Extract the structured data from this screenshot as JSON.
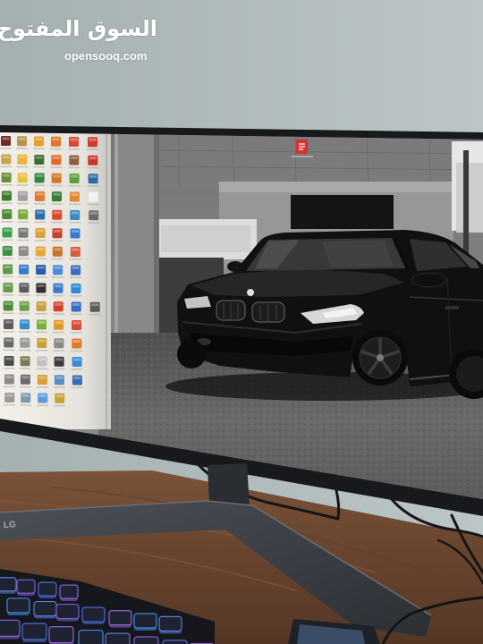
{
  "watermark": {
    "arabic": "السوق المفتوح",
    "latin": "opensooq.com"
  },
  "monitor": {
    "brand": "LG"
  },
  "desktop": {
    "pdf_icon_color": "#d8322c",
    "icon_colors": [
      [
        "#6e2a24",
        "#b89250",
        "#e2a02e",
        "#e0742a",
        "#d94a36",
        "#d33a2e"
      ],
      [
        "#c9a24a",
        "#e6b23a",
        "#3a6e2e",
        "#e06a2a",
        "#8e5a3a",
        "#c73428"
      ],
      [
        "#6a8e3a",
        "#e8c03a",
        "#2e8a3e",
        "#d8742a",
        "#5aa03a",
        "#2a6aa8"
      ],
      [
        "#3e7a2e",
        "#a0a0a0",
        "#e07a2a",
        "#3a7a3a",
        "#e08a30",
        "#f0f0f0"
      ],
      [
        "#4a8a3a",
        "#7aaa3a",
        "#2e6ea0",
        "#d84a2a",
        "#3a8ac0",
        "#6a6a6a"
      ],
      [
        "#3aa04a",
        "#7a7a7a",
        "#d8a03a",
        "#c8402a",
        "#3a7ad0",
        null
      ],
      [
        "#3e8e3e",
        "#8a8a8a",
        "#e6a63a",
        "#c9702a",
        "#d85a3a",
        null
      ],
      [
        "#5a9a4a",
        "#3a7ac8",
        "#2a5ab0",
        "#4a8ad8",
        "#3a6ac0",
        null
      ],
      [
        "#6a9a4a",
        "#5a5a5a",
        "#2e2e2e",
        "#3a78c8",
        "#2a8ad8",
        null
      ],
      [
        "#4a8a3a",
        "#6aa04a",
        "#c8a03a",
        "#d0402a",
        "#3a6ac8",
        "#5a5a5a"
      ],
      [
        "#5a5a5a",
        "#3a8ad0",
        "#7ab03a",
        "#e09a2a",
        "#d84a36",
        null
      ],
      [
        "#6a6a6a",
        "#9a9a9a",
        "#c8a03a",
        "#8a8a8a",
        "#e07a2a",
        null
      ],
      [
        "#4a4a4a",
        "#7a7a5a",
        "#c0c0c0",
        "#3a3a3a",
        "#3a8ad8",
        null
      ],
      [
        "#8a8a8a",
        "#6a6a6a",
        "#d8a03a",
        "#5a8ac0",
        "#3a6ab0",
        null
      ],
      [
        "#9a9a9a",
        "#7a9ab0",
        "#5a9ad8",
        "#c8a03a",
        null,
        null
      ]
    ]
  },
  "keyboard": {
    "glow_colors": [
      "#5b7bd6",
      "#7a5fd0",
      "#4a6cd9",
      "#8b63d8",
      "#3f8ae0"
    ]
  },
  "palette": {
    "wall": "#aab5b4",
    "desk": "#6e4a33",
    "bezel": "#17191c",
    "stand": "#3a3e44"
  }
}
